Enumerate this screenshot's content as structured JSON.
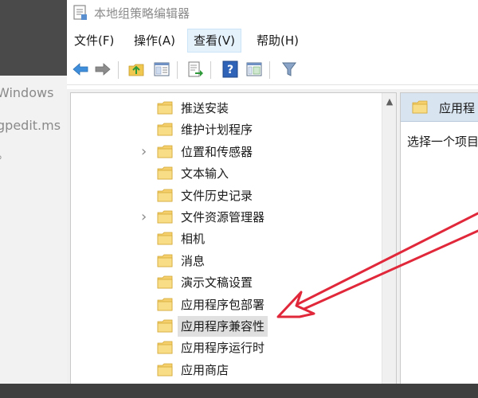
{
  "background": {
    "line1": "Windows",
    "line2": "gpedit.ms",
    "line3": "。"
  },
  "window": {
    "title": "本地组策略编辑器"
  },
  "menu": {
    "file": "文件(F)",
    "action": "操作(A)",
    "view": "查看(V)",
    "help": "帮助(H)"
  },
  "toolbar": {
    "buttons": [
      "back-arrow-icon",
      "forward-arrow-icon",
      "up-folder-icon",
      "show-hide-tree-icon",
      "export-list-icon",
      "help-icon",
      "properties-icon",
      "filter-icon"
    ]
  },
  "tree": {
    "items": [
      {
        "label": "推送安装",
        "expandable": false,
        "selected": false
      },
      {
        "label": "维护计划程序",
        "expandable": false,
        "selected": false
      },
      {
        "label": "位置和传感器",
        "expandable": true,
        "selected": false
      },
      {
        "label": "文本输入",
        "expandable": false,
        "selected": false
      },
      {
        "label": "文件历史记录",
        "expandable": false,
        "selected": false
      },
      {
        "label": "文件资源管理器",
        "expandable": true,
        "selected": false
      },
      {
        "label": "相机",
        "expandable": false,
        "selected": false
      },
      {
        "label": "消息",
        "expandable": false,
        "selected": false
      },
      {
        "label": "演示文稿设置",
        "expandable": false,
        "selected": false
      },
      {
        "label": "应用程序包部署",
        "expandable": false,
        "selected": false
      },
      {
        "label": "应用程序兼容性",
        "expandable": false,
        "selected": true
      },
      {
        "label": "应用程序运行时",
        "expandable": false,
        "selected": false
      },
      {
        "label": "应用商店",
        "expandable": false,
        "selected": false
      }
    ]
  },
  "right_pane": {
    "header": "应用程",
    "description": "选择一个项目"
  },
  "colors": {
    "arrow": "#e0283a",
    "folder": "#f4cf6b",
    "selection": "#e0e0e0"
  }
}
